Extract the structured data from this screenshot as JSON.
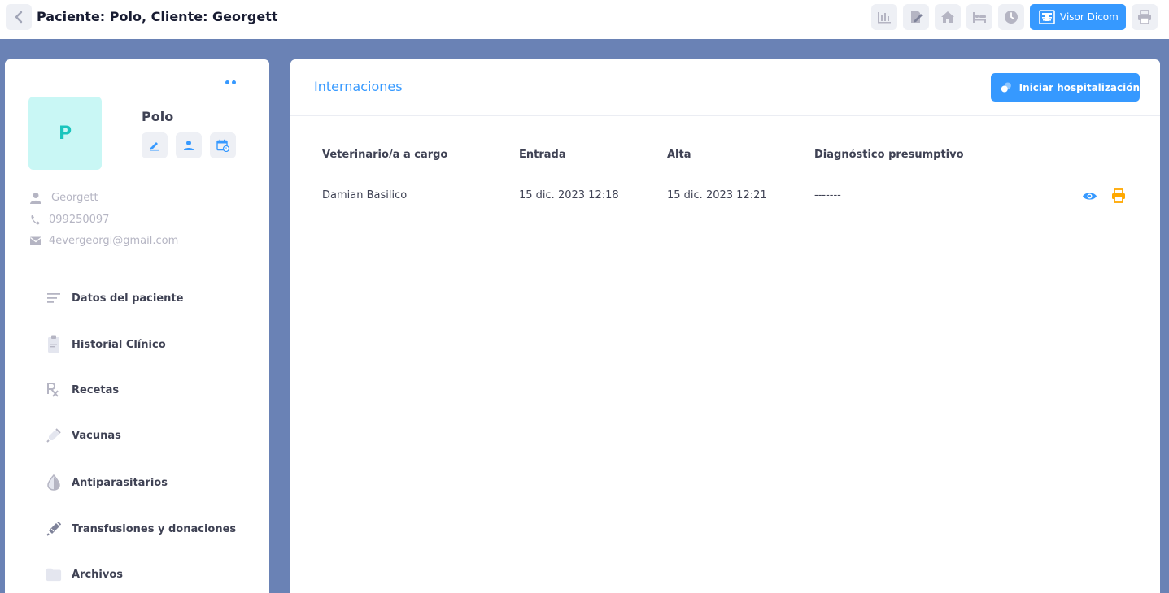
{
  "header": {
    "title": "Paciente: Polo, Cliente: Georgett",
    "toolbar_icons": [
      "chart-icon",
      "edit-document-icon",
      "home-icon",
      "bed-icon",
      "clock-icon"
    ],
    "dicom_label": "Visor Dicom",
    "print_icon": "print-icon"
  },
  "patient": {
    "avatar_letter": "P",
    "name": "Polo",
    "client_name": "Georgett",
    "phone": "099250097",
    "email": "4evergeorgi@gmail.com"
  },
  "nav": {
    "items": [
      {
        "label": "Datos del paciente",
        "icon": "list-icon"
      },
      {
        "label": "Historial Clínico",
        "icon": "clipboard-icon"
      },
      {
        "label": "Recetas",
        "icon": "rx-icon"
      },
      {
        "label": "Vacunas",
        "icon": "syringe-icon"
      },
      {
        "label": "Antiparasitarios",
        "icon": "drop-icon"
      },
      {
        "label": "Transfusiones y donaciones",
        "icon": "injection-icon"
      },
      {
        "label": "Archivos",
        "icon": "folder-icon"
      }
    ]
  },
  "main": {
    "title": "Internaciones",
    "start_button": "Iniciar hospitalización",
    "table": {
      "headers": [
        "Veterinario/a a cargo",
        "Entrada",
        "Alta",
        "Diagnóstico presumptivo"
      ],
      "rows": [
        {
          "vet": "Damian Basilico",
          "entrada": "15 dic. 2023 12:18",
          "alta": "15 dic. 2023 12:21",
          "diagnostico": "-------"
        }
      ]
    }
  },
  "colors": {
    "primary": "#3699ff",
    "page_bg": "#6a82b5",
    "avatar_bg": "#c9f7f5",
    "avatar_text": "#1bc5bd",
    "print_action": "#ffa800"
  }
}
